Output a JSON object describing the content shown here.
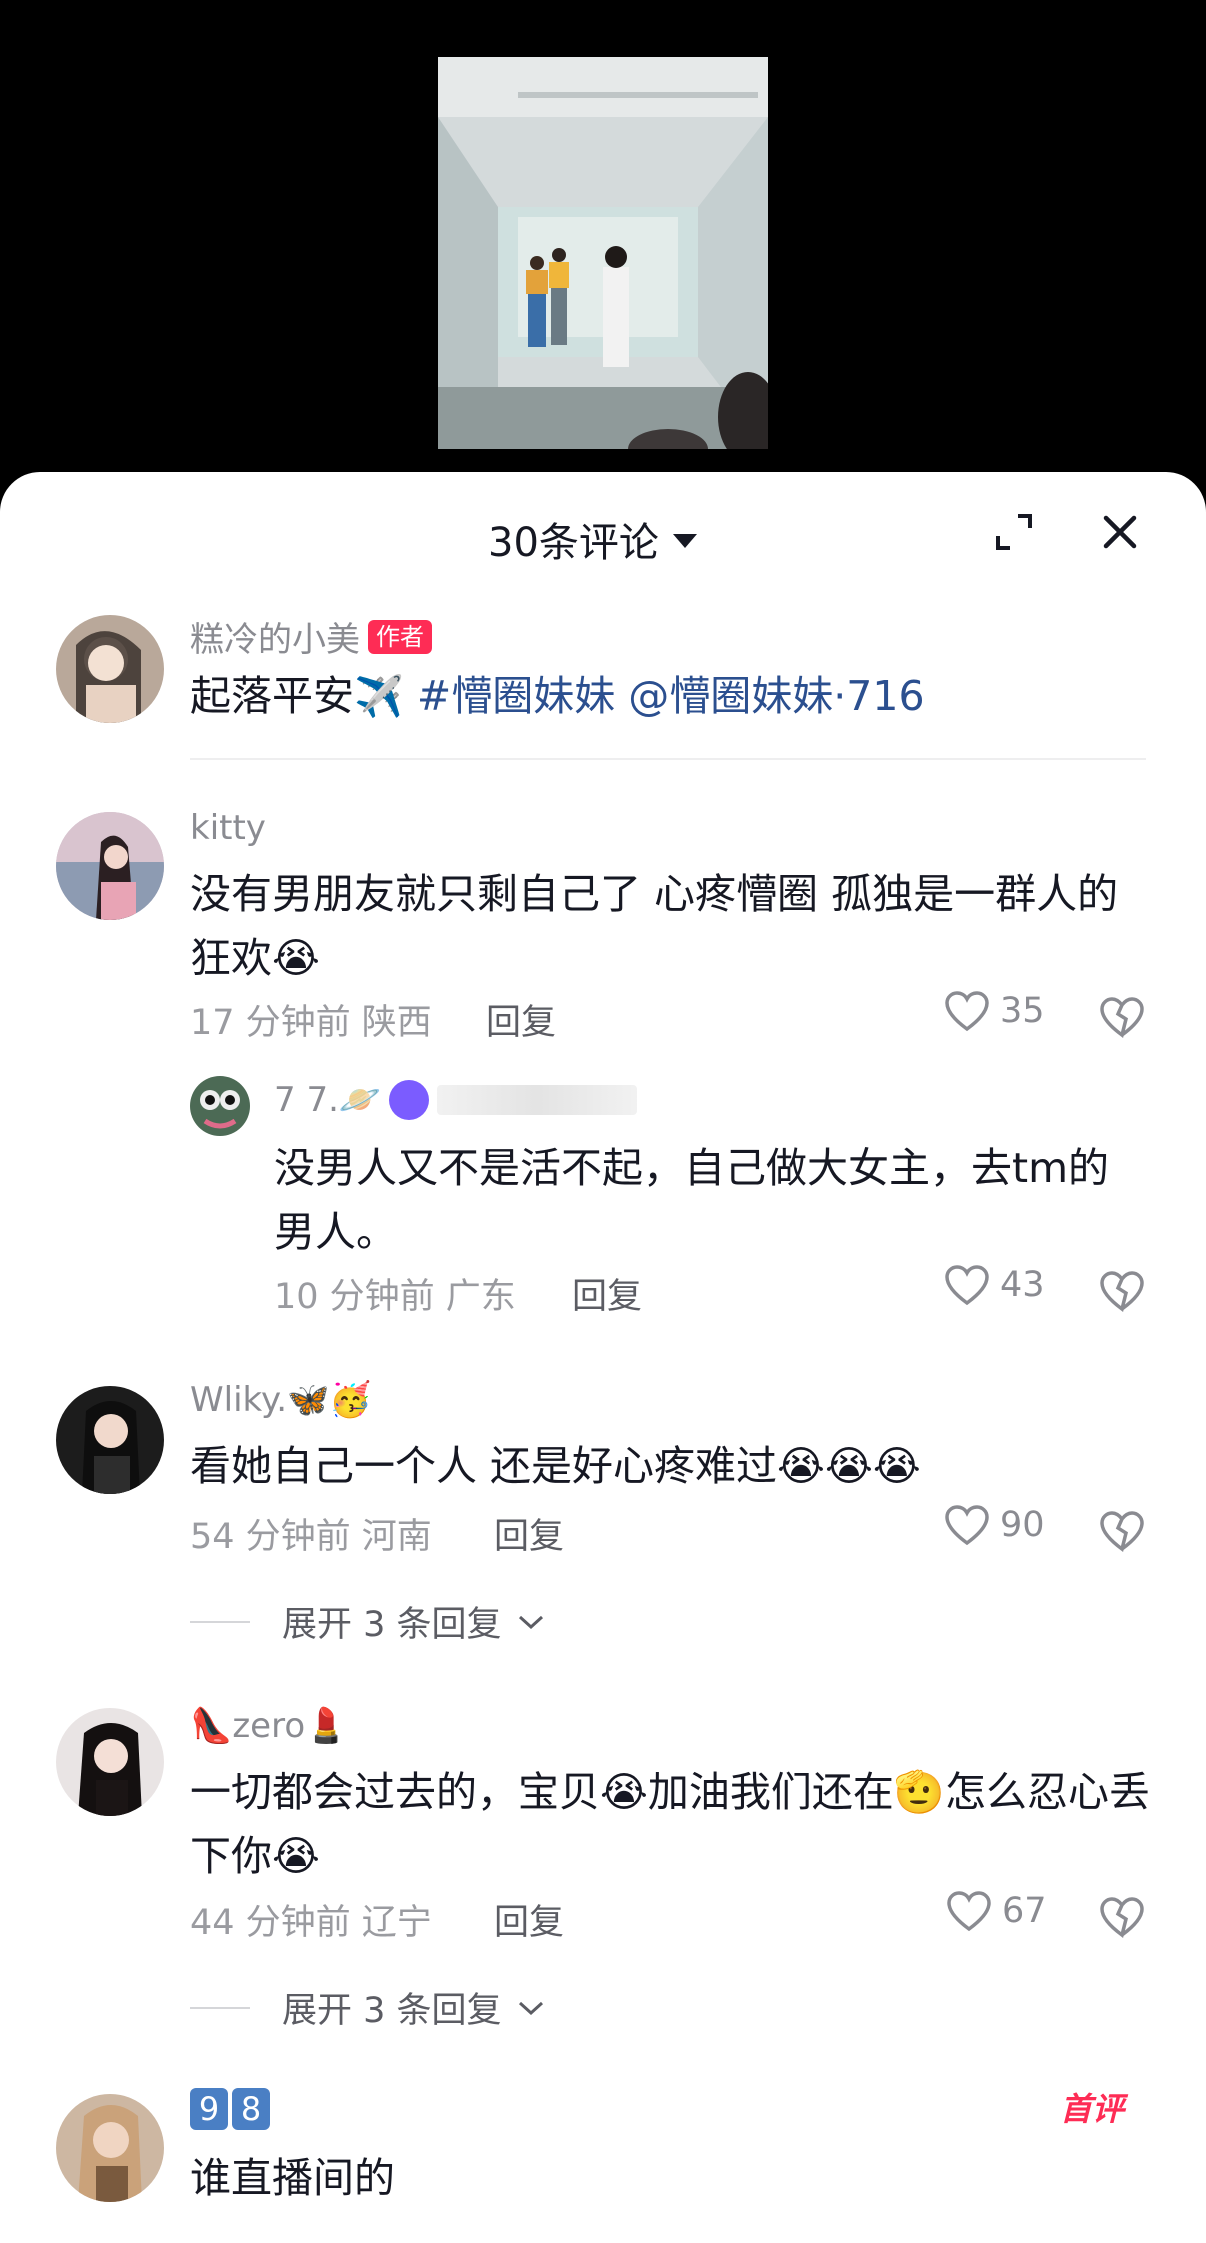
{
  "header": {
    "comment_count": "30条评论"
  },
  "comments": [
    {
      "username": "糕冷的小美",
      "author_badge": "作者",
      "text_plain": "起落平安",
      "emoji": "✈️",
      "hashtag": "#懵圈妹妹 @懵圈妹妹·716"
    },
    {
      "username": "kitty",
      "text": "没有男朋友就只剩自己了 心疼懵圈 孤独是一群人的狂欢😭",
      "time_loc": "17 分钟前 陕西",
      "reply_label": "回复",
      "likes": "35"
    },
    {
      "username": "7 7.🪐",
      "text": "没男人又不是活不起，自己做大女主，去tm的男人。",
      "time_loc": "10 分钟前 广东",
      "reply_label": "回复",
      "likes": "43"
    },
    {
      "username": "Wliky.🦋🥳",
      "text": "看她自己一个人 还是好心疼难过😭😭😭",
      "time_loc": "54 分钟前 河南",
      "reply_label": "回复",
      "likes": "90",
      "expand": "展开 3 条回复"
    },
    {
      "username": "👠zero💄",
      "text": "一切都会过去的，宝贝😭加油我们还在🫡怎么忍心丢下你😭",
      "time_loc": "44 分钟前 辽宁",
      "reply_label": "回复",
      "likes": "67",
      "expand": "展开 3 条回复"
    },
    {
      "username_digits": [
        "9",
        "8"
      ],
      "text": "谁直播间的",
      "first_badge": "首评"
    }
  ]
}
